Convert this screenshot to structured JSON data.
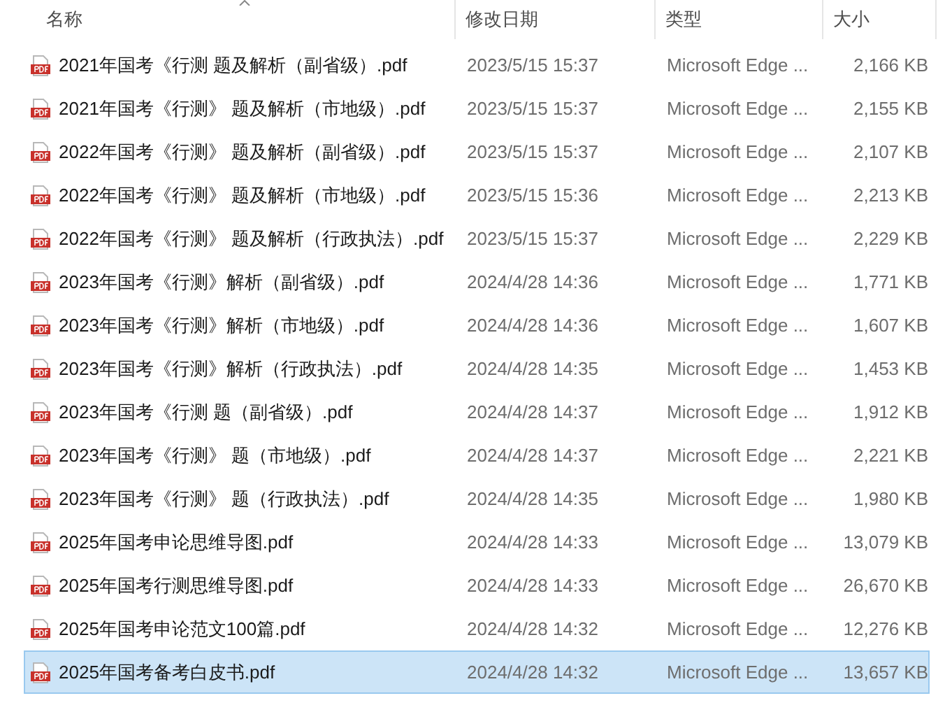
{
  "columns": [
    {
      "label": "名称",
      "sorted": true
    },
    {
      "label": "修改日期",
      "sorted": false
    },
    {
      "label": "类型",
      "sorted": false
    },
    {
      "label": "大小",
      "sorted": false
    }
  ],
  "files": [
    {
      "name": "2021年国考《行测 题及解析（副省级）.pdf",
      "modified": "2023/5/15 15:37",
      "type": "Microsoft Edge ...",
      "size": "2,166 KB",
      "selected": false
    },
    {
      "name": "2021年国考《行测》 题及解析（市地级）.pdf",
      "modified": "2023/5/15 15:37",
      "type": "Microsoft Edge ...",
      "size": "2,155 KB",
      "selected": false
    },
    {
      "name": "2022年国考《行测》 题及解析（副省级）.pdf",
      "modified": "2023/5/15 15:37",
      "type": "Microsoft Edge ...",
      "size": "2,107 KB",
      "selected": false
    },
    {
      "name": "2022年国考《行测》 题及解析（市地级）.pdf",
      "modified": "2023/5/15 15:36",
      "type": "Microsoft Edge ...",
      "size": "2,213 KB",
      "selected": false
    },
    {
      "name": "2022年国考《行测》 题及解析（行政执法）.pdf",
      "modified": "2023/5/15 15:37",
      "type": "Microsoft Edge ...",
      "size": "2,229 KB",
      "selected": false
    },
    {
      "name": "2023年国考《行测》解析（副省级）.pdf",
      "modified": "2024/4/28 14:36",
      "type": "Microsoft Edge ...",
      "size": "1,771 KB",
      "selected": false
    },
    {
      "name": "2023年国考《行测》解析（市地级）.pdf",
      "modified": "2024/4/28 14:36",
      "type": "Microsoft Edge ...",
      "size": "1,607 KB",
      "selected": false
    },
    {
      "name": "2023年国考《行测》解析（行政执法）.pdf",
      "modified": "2024/4/28 14:35",
      "type": "Microsoft Edge ...",
      "size": "1,453 KB",
      "selected": false
    },
    {
      "name": "2023年国考《行测 题（副省级）.pdf",
      "modified": "2024/4/28 14:37",
      "type": "Microsoft Edge ...",
      "size": "1,912 KB",
      "selected": false
    },
    {
      "name": "2023年国考《行测》 题（市地级）.pdf",
      "modified": "2024/4/28 14:37",
      "type": "Microsoft Edge ...",
      "size": "2,221 KB",
      "selected": false
    },
    {
      "name": "2023年国考《行测》 题（行政执法）.pdf",
      "modified": "2024/4/28 14:35",
      "type": "Microsoft Edge ...",
      "size": "1,980 KB",
      "selected": false
    },
    {
      "name": "2025年国考申论思维导图.pdf",
      "modified": "2024/4/28 14:33",
      "type": "Microsoft Edge ...",
      "size": "13,079 KB",
      "selected": false
    },
    {
      "name": "2025年国考行测思维导图.pdf",
      "modified": "2024/4/28 14:33",
      "type": "Microsoft Edge ...",
      "size": "26,670 KB",
      "selected": false
    },
    {
      "name": "2025年国考申论范文100篇.pdf",
      "modified": "2024/4/28 14:32",
      "type": "Microsoft Edge ...",
      "size": "12,276 KB",
      "selected": false
    },
    {
      "name": "2025年国考备考白皮书.pdf",
      "modified": "2024/4/28 14:32",
      "type": "Microsoft Edge ...",
      "size": "13,657 KB",
      "selected": true
    }
  ]
}
